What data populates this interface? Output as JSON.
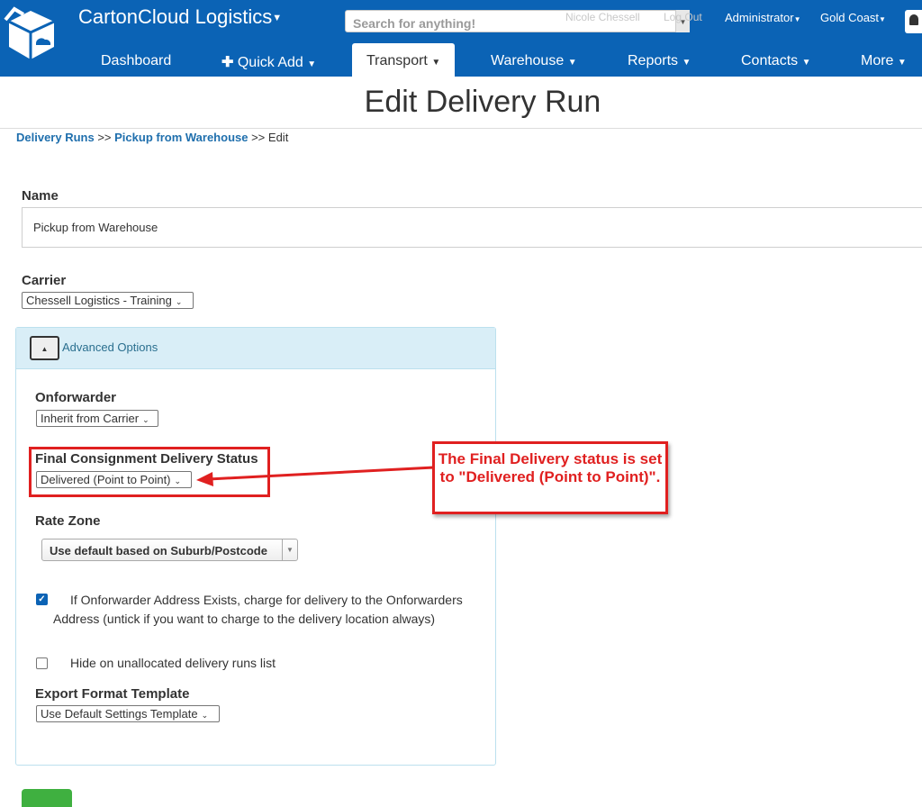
{
  "header": {
    "brand": "CartonCloud Logistics",
    "search_placeholder": "Search for anything!",
    "user_name": "Nicole Chessell",
    "logout": "Log Out",
    "role_menu": "Administrator",
    "location_menu": "Gold Coast"
  },
  "nav": {
    "dashboard": "Dashboard",
    "quick_add": "Quick Add",
    "transport": "Transport",
    "warehouse": "Warehouse",
    "reports": "Reports",
    "contacts": "Contacts",
    "more": "More"
  },
  "page": {
    "title": "Edit Delivery Run",
    "breadcrumb": {
      "link1": "Delivery Runs",
      "sep1": ">>",
      "link2": "Pickup from Warehouse",
      "sep2": ">>",
      "current": "Edit"
    }
  },
  "form": {
    "name_label": "Name",
    "name_value": "Pickup from Warehouse",
    "carrier_label": "Carrier",
    "carrier_value": "Chessell Logistics - Training",
    "advanced": {
      "title": "Advanced Options",
      "onforwarder_label": "Onforwarder",
      "onforwarder_value": "Inherit from Carrier",
      "final_status_label": "Final Consignment Delivery Status",
      "final_status_value": "Delivered (Point to Point)",
      "rate_zone_label": "Rate Zone",
      "rate_zone_value": "Use default based on Suburb/Postcode",
      "charge_onforwarder_checked": true,
      "charge_onforwarder_text": "If Onforwarder Address Exists, charge for delivery to the Onforwarders Address (untick if you want to charge to the delivery location always)",
      "hide_unallocated_checked": false,
      "hide_unallocated_text": "Hide on unallocated delivery runs list",
      "export_label": "Export Format Template",
      "export_value": "Use Default Settings Template"
    }
  },
  "annotation": {
    "callout_text": "The Final Delivery status is set to \"Delivered (Point to Point)\".",
    "color": "#e02020"
  },
  "colors": {
    "brand": "#0b63b5",
    "link": "#1f6fad",
    "panel_header": "#d9eef7",
    "save_button": "#3fb040"
  },
  "icons": {
    "logo": "cartoncloud-logo-icon",
    "bell": "bell-icon",
    "plus": "plus-icon",
    "collapse": "caret-up-icon"
  }
}
